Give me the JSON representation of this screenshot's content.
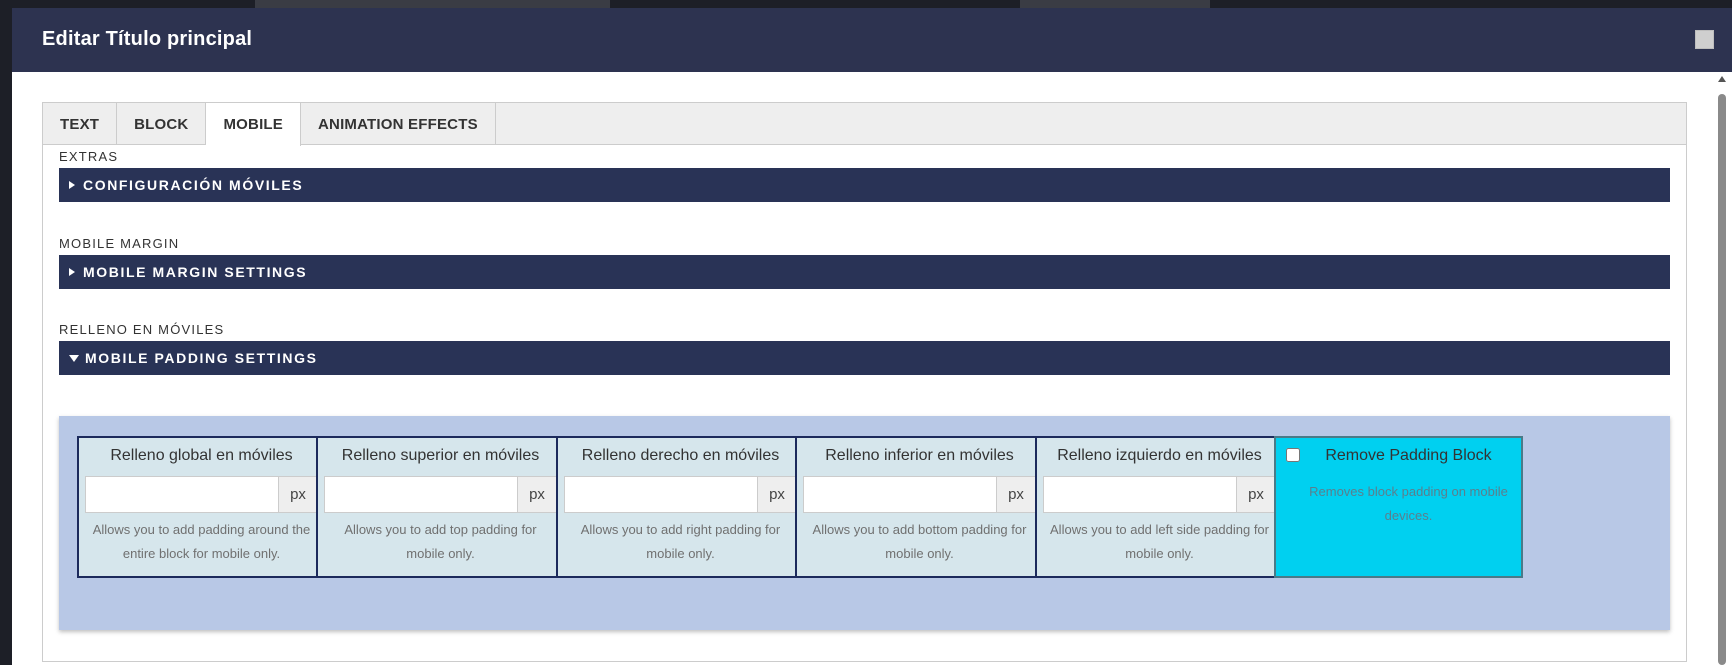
{
  "modal": {
    "title": "Editar Título principal"
  },
  "tabs": [
    {
      "label": "TEXT"
    },
    {
      "label": "BLOCK"
    },
    {
      "label": "MOBILE"
    },
    {
      "label": "ANIMATION EFFECTS"
    }
  ],
  "active_tab": "MOBILE",
  "sections": {
    "extras": {
      "label": "EXTRAS",
      "bar": "CONFIGURACIÓN MÓVILES",
      "expanded": false
    },
    "margin": {
      "label": "MOBILE MARGIN",
      "bar": "MOBILE MARGIN SETTINGS",
      "expanded": false
    },
    "padding": {
      "label": "RELLENO EN MÓVILES",
      "bar": "MOBILE PADDING SETTINGS",
      "expanded": true
    }
  },
  "padding_fields": [
    {
      "title": "Relleno global en móviles",
      "value": "",
      "unit": "px",
      "description": "Allows you to add padding around the entire block for mobile only."
    },
    {
      "title": "Relleno superior en móviles",
      "value": "",
      "unit": "px",
      "description": "Allows you to add top padding for mobile only."
    },
    {
      "title": "Relleno derecho en móviles",
      "value": "",
      "unit": "px",
      "description": "Allows you to add right padding for mobile only."
    },
    {
      "title": "Relleno inferior en móviles",
      "value": "",
      "unit": "px",
      "description": "Allows you to add bottom padding for mobile only."
    },
    {
      "title": "Relleno izquierdo en móviles",
      "value": "",
      "unit": "px",
      "description": "Allows you to add left side padding for mobile only."
    }
  ],
  "remove_padding": {
    "title": "Remove Padding Block",
    "description": "Removes block padding on mobile devices.",
    "checked": false
  },
  "colors": {
    "header": "#2d3350",
    "section_bar": "#293356",
    "padding_area": "#b8c8e6",
    "card_bg": "#d6e6ec",
    "card_border": "#1c2a5c",
    "remove_card_bg": "#00d0f0"
  },
  "icons": {
    "collapsed": "caret-right-icon",
    "expanded": "caret-down-icon",
    "close": "close-square-icon"
  }
}
